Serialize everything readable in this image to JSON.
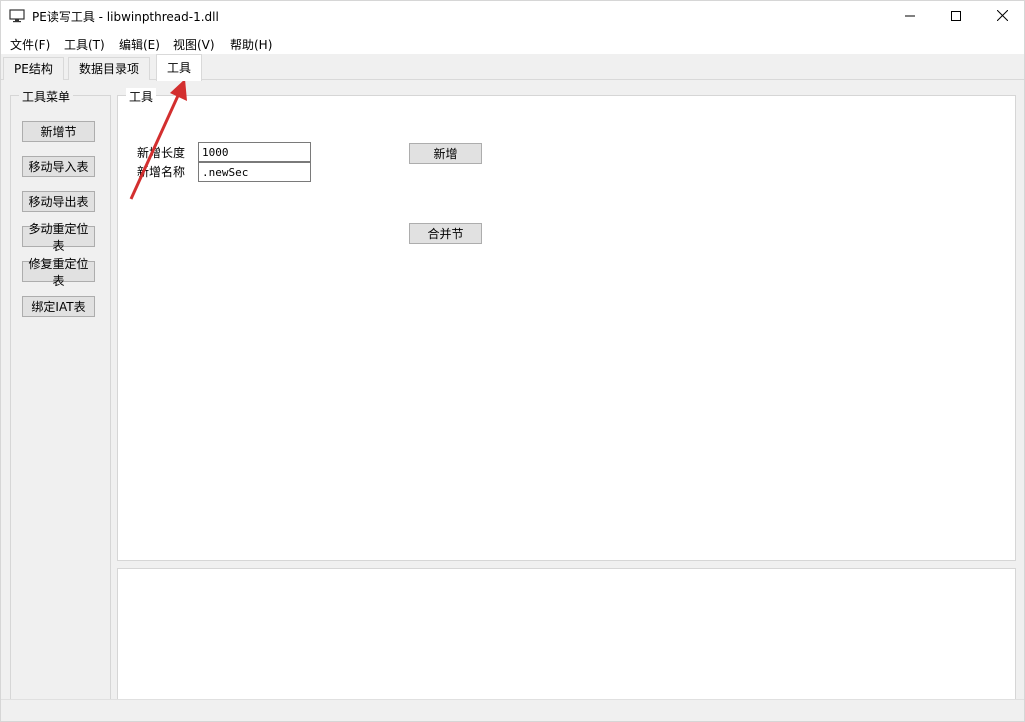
{
  "window": {
    "title": "PE读写工具 - libwinpthread-1.dll"
  },
  "menu": {
    "items": [
      "文件(F)",
      "工具(T)",
      "编辑(E)",
      "视图(V)",
      "帮助(H)"
    ]
  },
  "tabs": {
    "items": [
      "PE结构",
      "数据目录项",
      "工具"
    ],
    "active": "工具"
  },
  "sidebar": {
    "title": "工具菜单",
    "buttons": [
      "新增节",
      "移动导入表",
      "移动导出表",
      "多动重定位表",
      "修复重定位表",
      "绑定IAT表"
    ]
  },
  "tools": {
    "title": "工具",
    "length_label": "新增长度",
    "length_value": "1000",
    "name_label": "新增名称",
    "name_value": ".newSec",
    "add_button": "新增",
    "merge_button": "合并节"
  },
  "colors": {
    "accent_arrow": "#d32f2f"
  }
}
